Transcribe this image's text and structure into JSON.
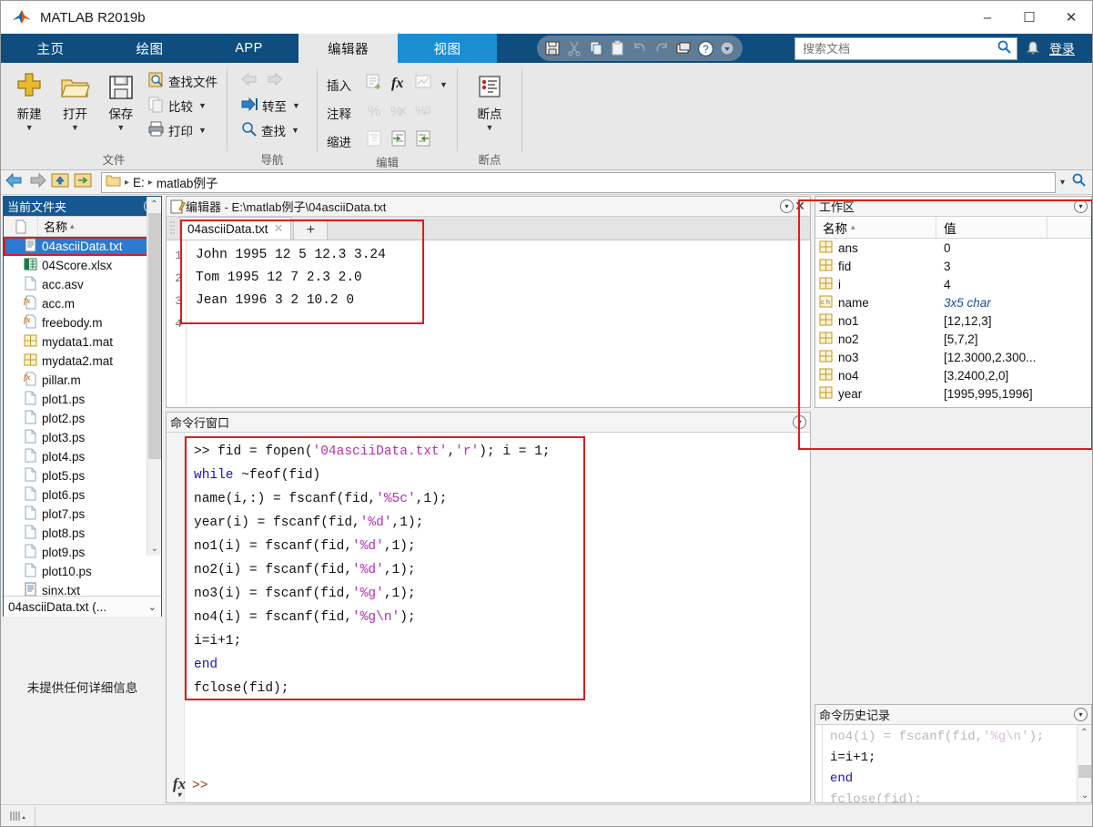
{
  "window": {
    "title": "MATLAB R2019b",
    "minimize": "–",
    "maximize": "☐",
    "close": "✕"
  },
  "ribbon": {
    "tabs": [
      {
        "label": "主页",
        "state": "normal"
      },
      {
        "label": "绘图",
        "state": "normal"
      },
      {
        "label": "APP",
        "state": "normal"
      },
      {
        "label": "编辑器",
        "state": "active"
      },
      {
        "label": "视图",
        "state": "hover"
      }
    ],
    "quick_access": [
      "save-icon",
      "cut-icon",
      "copy-icon",
      "paste-icon",
      "undo-icon",
      "redo-icon",
      "layout-icon",
      "help-icon",
      "qat-more-icon"
    ],
    "search": {
      "placeholder": "搜索文档",
      "value": "",
      "icon": "search-icon"
    },
    "bell": "notification-bell-icon",
    "login": "登录",
    "groups": [
      {
        "name": "文件",
        "big_buttons": [
          {
            "label": "新建",
            "icon": "new-file-icon",
            "caret": "▼"
          },
          {
            "label": "打开",
            "icon": "open-folder-icon",
            "caret": "▼"
          },
          {
            "label": "保存",
            "icon": "save-disk-icon",
            "caret": "▼"
          }
        ],
        "small_buttons": [
          {
            "label": "查找文件",
            "icon": "find-files-icon",
            "caret": ""
          },
          {
            "label": "比较",
            "icon": "compare-icon",
            "caret": "▼"
          },
          {
            "label": "打印",
            "icon": "print-icon",
            "caret": "▼"
          }
        ]
      },
      {
        "name": "导航",
        "small_buttons": [
          {
            "label": "",
            "icon": "back-arrow-icon",
            "caret": "",
            "dim": true
          },
          {
            "label": "转至",
            "icon": "goto-icon",
            "caret": "▼"
          },
          {
            "label": "查找",
            "icon": "search-magnifier-icon",
            "caret": "▼"
          }
        ]
      },
      {
        "name": "编辑",
        "rows": [
          {
            "label": "插入",
            "icons": [
              "insert-section-icon",
              "insert-function-icon",
              "insert-figure-icon"
            ],
            "caret": "▼"
          },
          {
            "label": "注释",
            "icons": [
              "comment-icon",
              "uncomment-icon",
              "wrap-comment-icon"
            ],
            "caret": ""
          },
          {
            "label": "缩进",
            "icons": [
              "smart-indent-icon",
              "indent-right-icon",
              "indent-left-icon"
            ],
            "caret": ""
          }
        ]
      },
      {
        "name": "断点",
        "big_buttons": [
          {
            "label": "断点",
            "icon": "breakpoint-icon",
            "caret": "▼"
          }
        ]
      }
    ]
  },
  "addressbar": {
    "back": "nav-back-icon",
    "forward": "nav-forward-icon",
    "up": "nav-up-icon",
    "browse": "nav-browse-icon",
    "folder_icon": "folder-icon",
    "crumbs": [
      "E:",
      "matlab例子"
    ],
    "separator": "▸",
    "dropdown_caret": "▾",
    "search_icon": "search-icon"
  },
  "current_folder": {
    "title": "当前文件夹",
    "columns": [
      "",
      "名称"
    ],
    "sort_arrow": "▴",
    "files": [
      {
        "name": "04asciiData.txt",
        "icon": "text-file-icon",
        "selected": true
      },
      {
        "name": "04Score.xlsx",
        "icon": "excel-file-icon",
        "selected": false
      },
      {
        "name": "acc.asv",
        "icon": "blank-file-icon",
        "selected": false
      },
      {
        "name": "acc.m",
        "icon": "m-file-icon",
        "selected": false
      },
      {
        "name": "freebody.m",
        "icon": "m-file-icon",
        "selected": false
      },
      {
        "name": "mydata1.mat",
        "icon": "mat-file-icon",
        "selected": false
      },
      {
        "name": "mydata2.mat",
        "icon": "mat-file-icon",
        "selected": false
      },
      {
        "name": "pillar.m",
        "icon": "m-file-icon",
        "selected": false
      },
      {
        "name": "plot1.ps",
        "icon": "blank-file-icon",
        "selected": false
      },
      {
        "name": "plot2.ps",
        "icon": "blank-file-icon",
        "selected": false
      },
      {
        "name": "plot3.ps",
        "icon": "blank-file-icon",
        "selected": false
      },
      {
        "name": "plot4.ps",
        "icon": "blank-file-icon",
        "selected": false
      },
      {
        "name": "plot5.ps",
        "icon": "blank-file-icon",
        "selected": false
      },
      {
        "name": "plot6.ps",
        "icon": "blank-file-icon",
        "selected": false
      },
      {
        "name": "plot7.ps",
        "icon": "blank-file-icon",
        "selected": false
      },
      {
        "name": "plot8.ps",
        "icon": "blank-file-icon",
        "selected": false
      },
      {
        "name": "plot9.ps",
        "icon": "blank-file-icon",
        "selected": false
      },
      {
        "name": "plot10.ps",
        "icon": "blank-file-icon",
        "selected": false
      },
      {
        "name": "sinx.txt",
        "icon": "text-file-icon",
        "selected": false
      }
    ],
    "footer_label": "04asciiData.txt  (...",
    "footer_caret": "⌄",
    "details_text": "未提供任何详细信息",
    "scroll_up": "⌃",
    "scroll_down": "⌄"
  },
  "editor": {
    "title": "编辑器 - E:\\matlab例子\\04asciiData.txt",
    "icon": "editor-icon",
    "dropdown_caret": "▾",
    "close": "✕",
    "tab": {
      "label": "04asciiData.txt",
      "close": "✕"
    },
    "new_tab": "+",
    "line_numbers": [
      "1",
      "2",
      "3",
      "4"
    ],
    "lines": [
      "John 1995 12 5 12.3 3.24",
      "Tom 1995 12 7 2.3 2.0",
      "Jean 1996 3 2 10.2 0",
      ""
    ]
  },
  "command_window": {
    "title": "命令行窗口",
    "dropdown_caret": "▾",
    "prompt": ">>",
    "fx_icon": "fx-icon",
    "lines": [
      [
        {
          "t": ">> ",
          "c": "prompt"
        },
        {
          "t": "fid = fopen(",
          "c": "plain"
        },
        {
          "t": "'04asciiData.txt'",
          "c": "str"
        },
        {
          "t": ",",
          "c": "plain"
        },
        {
          "t": "'r'",
          "c": "str"
        },
        {
          "t": "); i = 1;",
          "c": "plain"
        }
      ],
      [
        {
          "t": "while",
          "c": "kw"
        },
        {
          "t": " ~feof(fid)",
          "c": "plain"
        }
      ],
      [
        {
          "t": "name(i,:) = fscanf(fid,",
          "c": "plain"
        },
        {
          "t": "'%5c'",
          "c": "str"
        },
        {
          "t": ",1);",
          "c": "plain"
        }
      ],
      [
        {
          "t": "year(i) = fscanf(fid,",
          "c": "plain"
        },
        {
          "t": "'%d'",
          "c": "str"
        },
        {
          "t": ",1);",
          "c": "plain"
        }
      ],
      [
        {
          "t": "no1(i) = fscanf(fid,",
          "c": "plain"
        },
        {
          "t": "'%d'",
          "c": "str"
        },
        {
          "t": ",1);",
          "c": "plain"
        }
      ],
      [
        {
          "t": "no2(i) = fscanf(fid,",
          "c": "plain"
        },
        {
          "t": "'%d'",
          "c": "str"
        },
        {
          "t": ",1);",
          "c": "plain"
        }
      ],
      [
        {
          "t": "no3(i) = fscanf(fid,",
          "c": "plain"
        },
        {
          "t": "'%g'",
          "c": "str"
        },
        {
          "t": ",1);",
          "c": "plain"
        }
      ],
      [
        {
          "t": "no4(i) = fscanf(fid,",
          "c": "plain"
        },
        {
          "t": "'%g\\n'",
          "c": "str"
        },
        {
          "t": ");",
          "c": "plain"
        }
      ],
      [
        {
          "t": "i=i+1;",
          "c": "plain"
        }
      ],
      [
        {
          "t": "end",
          "c": "kw"
        }
      ],
      [
        {
          "t": "fclose(fid);",
          "c": "plain"
        }
      ]
    ]
  },
  "workspace": {
    "title": "工作区",
    "dropdown_caret": "▾",
    "columns": [
      "名称",
      "值",
      ""
    ],
    "sort_arrow": "▴",
    "rows": [
      {
        "name": "ans",
        "value": "0",
        "icon": "matrix-icon",
        "italic": false
      },
      {
        "name": "fid",
        "value": "3",
        "icon": "matrix-icon",
        "italic": false
      },
      {
        "name": "i",
        "value": "4",
        "icon": "matrix-icon",
        "italic": false
      },
      {
        "name": "name",
        "value": "3x5 char",
        "icon": "char-icon",
        "italic": true
      },
      {
        "name": "no1",
        "value": "[12,12,3]",
        "icon": "matrix-icon",
        "italic": false
      },
      {
        "name": "no2",
        "value": "[5,7,2]",
        "icon": "matrix-icon",
        "italic": false
      },
      {
        "name": "no3",
        "value": "[12.3000,2.300...",
        "icon": "matrix-icon",
        "italic": false
      },
      {
        "name": "no4",
        "value": "[3.2400,2,0]",
        "icon": "matrix-icon",
        "italic": false
      },
      {
        "name": "year",
        "value": "[1995,995,1996]",
        "icon": "matrix-icon",
        "italic": false
      }
    ]
  },
  "command_history": {
    "title": "命令历史记录",
    "dropdown_caret": "▾",
    "lines": [
      [
        {
          "t": "no4(i) = fscanf(fid,",
          "c": "faded"
        },
        {
          "t": "'%g\\n'",
          "c": "faded-str"
        },
        {
          "t": ");",
          "c": "faded"
        }
      ],
      [
        {
          "t": "i=i+1;",
          "c": "plain"
        }
      ],
      [
        {
          "t": "end",
          "c": "kw"
        }
      ],
      [
        {
          "t": "fclose(fid);",
          "c": "faded"
        }
      ]
    ],
    "scroll_up": "⌃",
    "scroll_down": "⌄"
  },
  "status_bar": {
    "grip_icon": "resize-grip-icon"
  },
  "colors": {
    "ribbon_blue": "#0e4d7e",
    "tab_hover_blue": "#1a8ed1",
    "selection_blue": "#2a7ad2",
    "annotation_red": "#e01b1b",
    "keyword_blue": "#1414c8",
    "string_magenta": "#b52fb5",
    "prompt_orange": "#a03a1e"
  }
}
